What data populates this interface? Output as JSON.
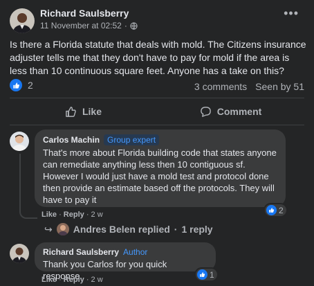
{
  "post": {
    "author": "Richard Saulsberry",
    "timestamp": "11 November at 02:52",
    "separator": "·",
    "privacy_icon": "globe-icon",
    "more_icon": "more-options-icon",
    "more_text": "•••",
    "text": "Is there a Florida statute that deals with mold. The Citizens insurance adjuster tells me that they don't have to pay for mold if the area is less than 10 continuous square feet. Anyone has a take on this?",
    "reaction_count": "2",
    "comments_count": "3 comments",
    "seen_by": "Seen by 51"
  },
  "actions": {
    "like_label": "Like",
    "comment_label": "Comment"
  },
  "comments": [
    {
      "author": "Carlos Machin",
      "badge": "Group expert",
      "text": "That's more about Florida building code that states anyone can remediate anything less then 10 contiguous sf. However I would just have a mold test and protocol done then provide an estimate based off the protocols. They will have to pay it",
      "like_label": "Like",
      "reply_label": "Reply",
      "time": "2 w",
      "reaction_count": "2",
      "reply_summary_name": "Andres Belen replied",
      "reply_summary_count": "1 reply"
    },
    {
      "author": "Richard Saulsberry",
      "badge": "Author",
      "text": "Thank you Carlos for you quick response.",
      "like_label": "Like",
      "reply_label": "Reply",
      "time": "2 w",
      "reaction_count": "1"
    }
  ],
  "colors": {
    "background": "#242526",
    "bubble": "#3a3b3c",
    "accent": "#1877f2",
    "badge_text": "#4599ff",
    "secondary_text": "#b0b3b8"
  }
}
